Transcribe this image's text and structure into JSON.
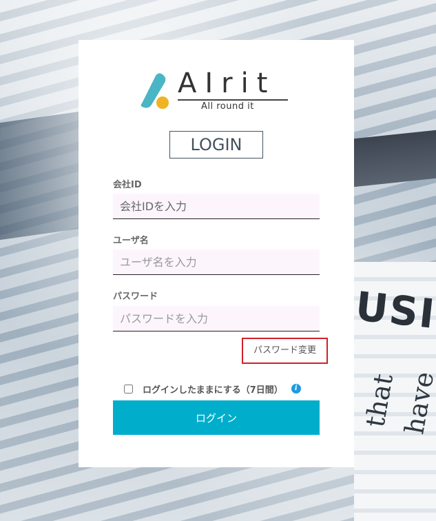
{
  "logo": {
    "word": "AIrit",
    "tagline": "All round it",
    "colors": {
      "teal": "#4ab5c4",
      "yellow": "#f0b323"
    }
  },
  "login_title": "LOGIN",
  "fields": {
    "company_id": {
      "label": "会社ID",
      "placeholder": "会社IDを入力",
      "value": ""
    },
    "username": {
      "label": "ユーザ名",
      "placeholder": "ユーザ名を入力",
      "value": ""
    },
    "password": {
      "label": "パスワード",
      "placeholder": "パスワードを入力",
      "value": ""
    }
  },
  "password_change_label": "パスワード変更",
  "remember": {
    "label": "ログインしたままにする（7日間）",
    "checked": false,
    "info_icon": "info-icon"
  },
  "login_button_label": "ログイン",
  "background_text": {
    "headline": "USINI",
    "script": "that have"
  },
  "colors": {
    "accent": "#00aecc",
    "highlight_border": "#d0202a",
    "field_bg": "#fdf5fc"
  }
}
